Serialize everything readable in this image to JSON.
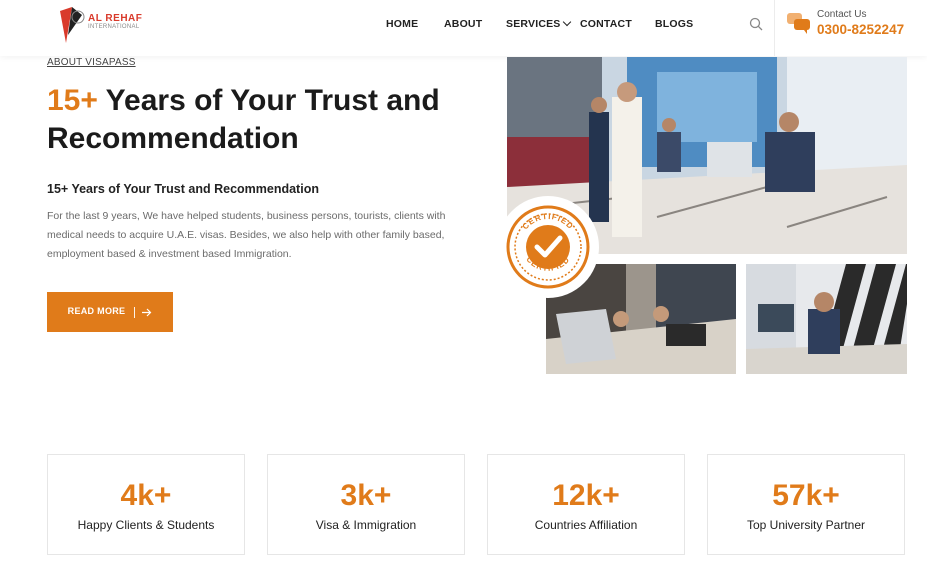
{
  "header": {
    "logo_text": "AL REHAF",
    "logo_sub": "INTERNATIONAL",
    "nav": [
      "HOME",
      "ABOUT",
      "SERVICES",
      "CONTACT",
      "BLOGS"
    ],
    "contact_label": "Contact Us",
    "contact_phone": "0300-8252247"
  },
  "hero": {
    "eyebrow": "ABOUT VISAPASS",
    "title_accent": "15+",
    "title_rest": " Years of Your Trust and Recommendation",
    "subheading": "15+ Years of Your Trust and Recommendation",
    "paragraph": "For the last 9 years, We have helped students, business persons, tourists, clients with medical needs to acquire U.A.E. visas. Besides, we also help with other family based, employment based & investment based Immigration.",
    "button_label": "READ MORE"
  },
  "badge": {
    "text": "CERTIFIED"
  },
  "stats": [
    {
      "value": "4k+",
      "label": "Happy Clients & Students"
    },
    {
      "value": "3k+",
      "label": "Visa & Immigration"
    },
    {
      "value": "12k+",
      "label": "Countries Affiliation"
    },
    {
      "value": "57k+",
      "label": "Top University Partner"
    }
  ],
  "colors": {
    "accent": "#e07b1a",
    "brand_red": "#d93a2b"
  }
}
